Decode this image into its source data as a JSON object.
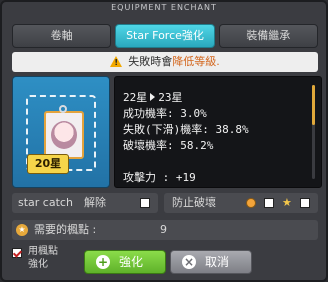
{
  "window": {
    "title": "EQUIPMENT ENCHANT"
  },
  "tabs": [
    {
      "label": "卷軸"
    },
    {
      "label": "Star Force強化"
    },
    {
      "label": "裝備繼承"
    }
  ],
  "warning": {
    "prefix": "失敗時會",
    "highlight": "降低等級."
  },
  "item": {
    "star_badge": "20星"
  },
  "stats": {
    "star_from": "22星",
    "star_to": "23星",
    "success_label": "成功機率:",
    "success_value": "3.0%",
    "fail_label": "失敗(下滑)機率:",
    "fail_value": "38.8%",
    "destroy_label": "破壞機率:",
    "destroy_value": "58.2%",
    "attack_label": "攻擊力 :",
    "attack_value": "+19"
  },
  "options": {
    "star_catch_label": "star catch",
    "star_catch_disable": "解除",
    "prevent_destroy_label": "防止破壞"
  },
  "points": {
    "label": "需要的楓點 :",
    "value": "9"
  },
  "use_maple_points": {
    "label_line1": "用楓點",
    "label_line2": "強化"
  },
  "buttons": {
    "enhance": "強化",
    "cancel": "取消"
  }
}
